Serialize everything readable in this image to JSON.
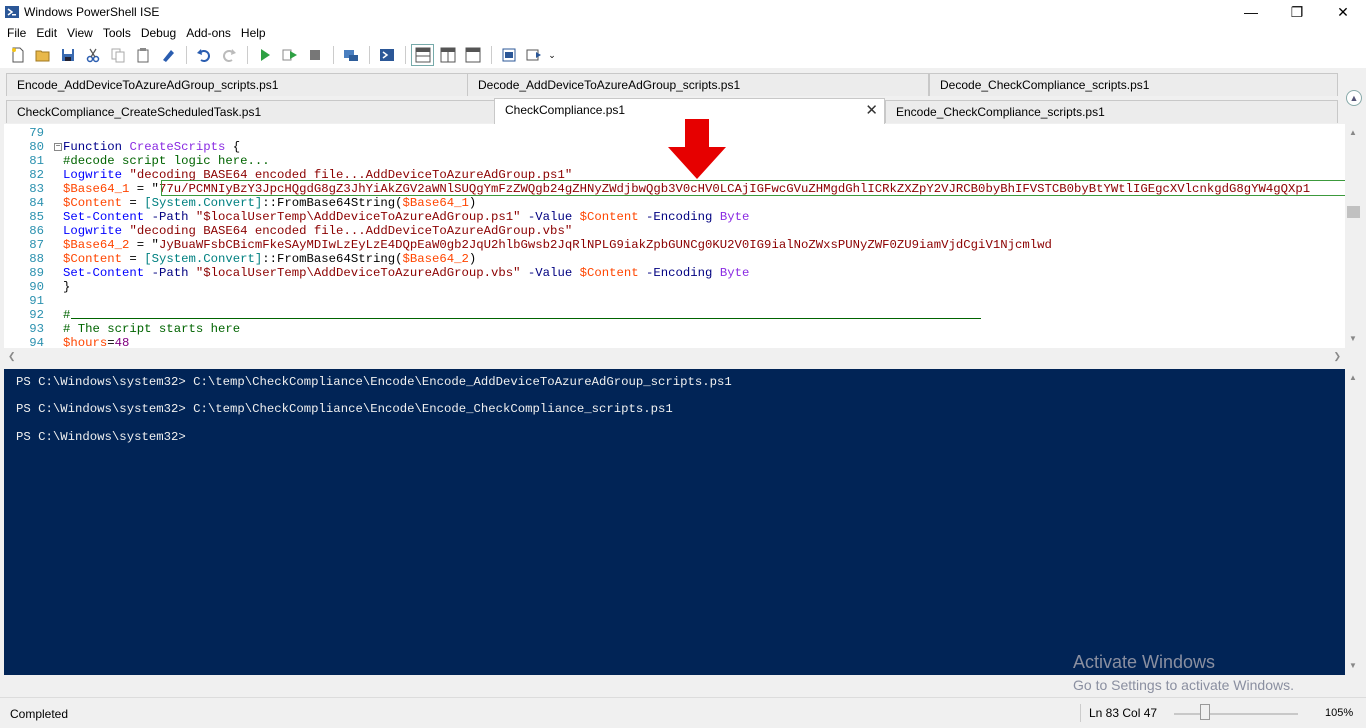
{
  "window": {
    "title": "Windows PowerShell ISE"
  },
  "menu": [
    "File",
    "Edit",
    "View",
    "Tools",
    "Debug",
    "Add-ons",
    "Help"
  ],
  "tabs": {
    "row1": [
      "Encode_AddDeviceToAzureAdGroup_scripts.ps1",
      "Decode_AddDeviceToAzureAdGroup_scripts.ps1",
      "Decode_CheckCompliance_scripts.ps1"
    ],
    "row2": [
      "CheckCompliance_CreateScheduledTask.ps1",
      "CheckCompliance.ps1",
      "Encode_CheckCompliance_scripts.ps1"
    ]
  },
  "editor": {
    "line_numbers": [
      "79",
      "80",
      "81",
      "82",
      "83",
      "84",
      "85",
      "86",
      "87",
      "88",
      "89",
      "90",
      "91",
      "92",
      "93",
      "94"
    ],
    "l80": {
      "kw": "Function",
      "fn": "CreateScripts",
      "rest": " {"
    },
    "l81": "#decode script logic here...",
    "l82": {
      "cmd": "Logwrite",
      "str": "\"decoding BASE64 encoded file...AddDeviceToAzureAdGroup.ps1\""
    },
    "l83": {
      "var": "$Base64_1",
      "op": " = \"",
      "str": "77u/PCMNIyBzY3JpcHQgdG8gZ3JhYiAkZGV2aWNlSUQgYmFzZWQgb24gZHNyZWdjbwQgb3V0cHV0LCAjIGFwcGVuZHMgdGhlICRkZXZpY2VJRCB0byBhIFVSTCB0byBtYWtlIGEgcXVlcnkgdG8gYW4gQXp1"
    },
    "l84": {
      "var": "$Content",
      "op": " = ",
      "typ": "[System.Convert]",
      "rest": "::FromBase64String(",
      "var2": "$Base64_1",
      "close": ")"
    },
    "l85": {
      "cmd": "Set-Content",
      "p1": " -Path ",
      "str": "\"$localUserTemp\\AddDeviceToAzureAdGroup.ps1\"",
      "p2": " -Value ",
      "var": "$Content",
      "p3": " -Encoding ",
      "val": "Byte"
    },
    "l86": {
      "cmd": "Logwrite",
      "str": "\"decoding BASE64 encoded file...AddDeviceToAzureAdGroup.vbs\""
    },
    "l87": {
      "var": "$Base64_2",
      "op": " = \"",
      "str": "JyBuaWFsbCBicmFkeSAyMDIwLzEyLzE4DQpEaW0gb2JqU2hlbGwsb2JqRlNPLG9iakZpbGUNCg0KU2V0IG9ialNoZWxsPUNyZWF0ZU9iamVjdCgiV1Njcmlwd"
    },
    "l88": {
      "var": "$Content",
      "op": " = ",
      "typ": "[System.Convert]",
      "rest": "::FromBase64String(",
      "var2": "$Base64_2",
      "close": ")"
    },
    "l89": {
      "cmd": "Set-Content",
      "p1": " -Path ",
      "str": "\"$localUserTemp\\AddDeviceToAzureAdGroup.vbs\"",
      "p2": " -Value ",
      "var": "$Content",
      "p3": " -Encoding ",
      "val": "Byte"
    },
    "l90": "}",
    "l92": "#",
    "l93": "# The script starts here",
    "l94": {
      "var": "$hours",
      "op": "=",
      "num": "48"
    }
  },
  "console": {
    "lines": [
      "PS C:\\Windows\\system32> C:\\temp\\CheckCompliance\\Encode\\Encode_AddDeviceToAzureAdGroup_scripts.ps1",
      "PS C:\\Windows\\system32> C:\\temp\\CheckCompliance\\Encode\\Encode_CheckCompliance_scripts.ps1",
      "PS C:\\Windows\\system32>"
    ]
  },
  "watermark": {
    "line1": "Activate Windows",
    "line2": "Go to Settings to activate Windows."
  },
  "status": {
    "text": "Completed",
    "position": "Ln 83  Col 47",
    "zoom": "105%",
    "zoom_level": 0.25
  },
  "colors": {
    "console_bg": "#012456",
    "arrow": "#e60000",
    "highlight": "#3c9a3c"
  }
}
